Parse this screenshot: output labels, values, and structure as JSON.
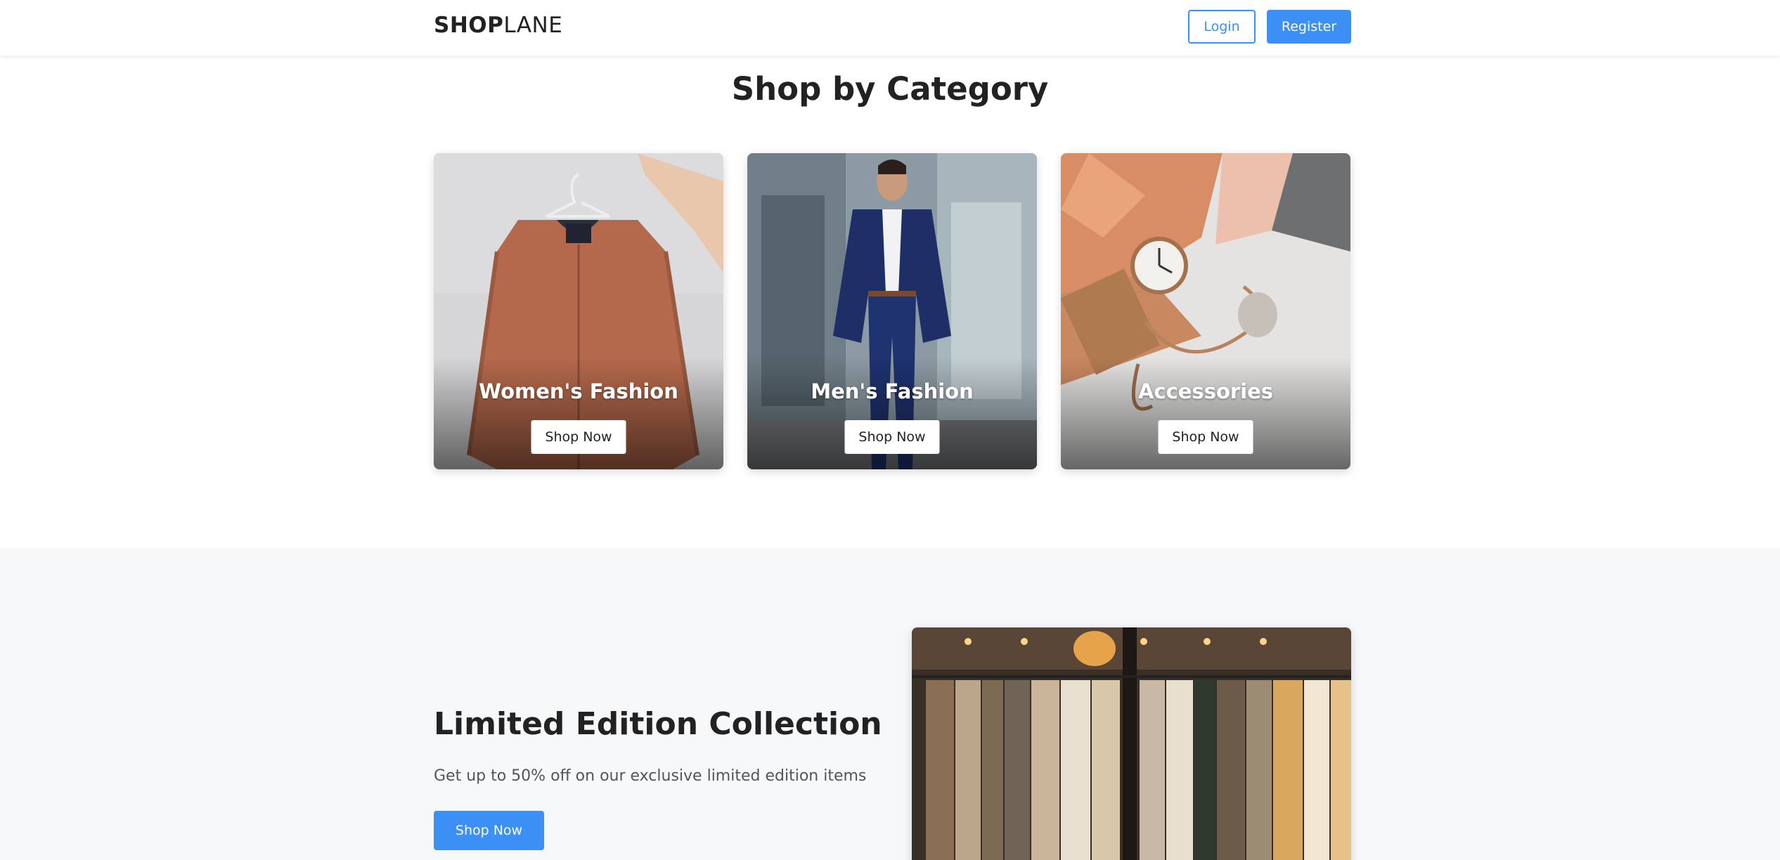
{
  "header": {
    "logo_bold": "SHOP",
    "logo_light": "LANE",
    "login_label": "Login",
    "register_label": "Register"
  },
  "categories": {
    "title": "Shop by Category",
    "items": [
      {
        "name": "Women's Fashion",
        "button": "Shop Now",
        "image": "orange-bomber-jacket-on-hanger"
      },
      {
        "name": "Men's Fashion",
        "button": "Shop Now",
        "image": "man-in-navy-suit"
      },
      {
        "name": "Accessories",
        "button": "Shop Now",
        "image": "watch-and-jewelry-on-silk"
      }
    ]
  },
  "promo": {
    "title": "Limited Edition Collection",
    "subtitle": "Get up to 50% off on our exclusive limited edition items",
    "button": "Shop Now",
    "image": "clothing-racks-in-store"
  },
  "colors": {
    "accent": "#3b8ff5",
    "promo_bg": "#f7f8fa",
    "text_dark": "#222222"
  }
}
